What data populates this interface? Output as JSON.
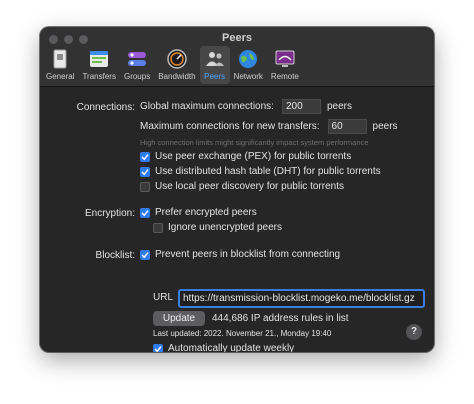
{
  "window": {
    "title": "Peers"
  },
  "tabs": [
    {
      "label": "General",
      "icon": "general-icon",
      "active": false
    },
    {
      "label": "Transfers",
      "icon": "transfers-icon",
      "active": false
    },
    {
      "label": "Groups",
      "icon": "groups-icon",
      "active": false
    },
    {
      "label": "Bandwidth",
      "icon": "bandwidth-icon",
      "active": false
    },
    {
      "label": "Peers",
      "icon": "peers-icon",
      "active": true
    },
    {
      "label": "Network",
      "icon": "network-icon",
      "active": false
    },
    {
      "label": "Remote",
      "icon": "remote-icon",
      "active": false
    }
  ],
  "connections": {
    "label": "Connections:",
    "global_label": "Global maximum connections:",
    "global_value": "200",
    "global_unit": "peers",
    "transfer_label": "Maximum connections for new transfers:",
    "transfer_value": "60",
    "transfer_unit": "peers",
    "hint": "High connection limits might significantly impact system performance",
    "options": [
      {
        "label": "Use peer exchange (PEX) for public torrents",
        "checked": true
      },
      {
        "label": "Use distributed hash table (DHT) for public torrents",
        "checked": true
      },
      {
        "label": "Use local peer discovery for public torrents",
        "checked": false
      }
    ]
  },
  "encryption": {
    "label": "Encryption:",
    "options": [
      {
        "label": "Prefer encrypted peers",
        "checked": true
      },
      {
        "label": "Ignore unencrypted peers",
        "checked": false
      }
    ]
  },
  "blocklist": {
    "label": "Blocklist:",
    "enable_label": "Prevent peers in blocklist from connecting",
    "enable_checked": true,
    "url_label": "URL",
    "url_value": "https://transmission-blocklist.mogeko.me/blocklist.gz",
    "update_button": "Update",
    "rules_text": "444,686 IP address rules in list",
    "last_updated": "Last updated: 2022. November 21., Monday 19:40",
    "auto_update_label": "Automatically update weekly",
    "auto_update_checked": true
  },
  "help": {
    "label": "?"
  },
  "colors": {
    "accent": "#2f7bf5",
    "window_bg": "#262627",
    "active_tab_label": "#4ea6ff"
  }
}
